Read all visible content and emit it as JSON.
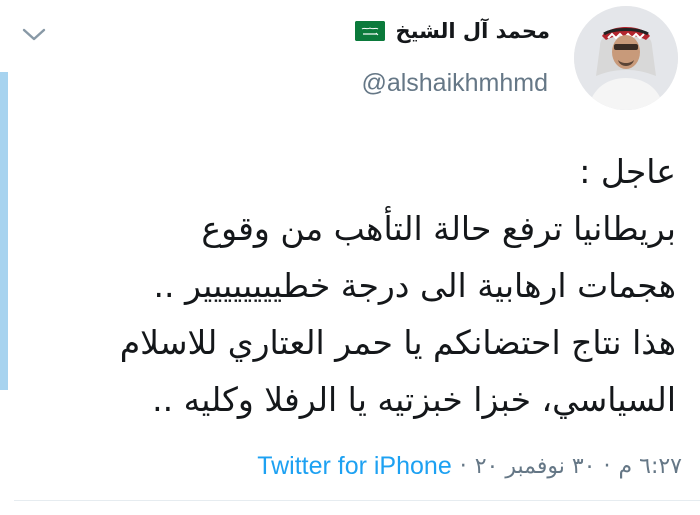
{
  "user": {
    "display_name": "محمد آل الشيخ",
    "handle": "@alshaikhmhmd",
    "flag_icon": "saudi-flag-icon",
    "avatar_icon": "profile-photo"
  },
  "tweet": {
    "lines": [
      "عاجل :",
      "بريطانيا ترفع حالة التأهب من وقوع",
      "هجمات ارهابية  الى درجة خطيييييييير ..",
      "هذا نتاج احتضانكم يا حمر العتاري للاسلام",
      "السياسي، خبزا خبزتيه يا الرفلا وكليه .."
    ]
  },
  "meta": {
    "time": "٦:٢٧ م",
    "date": "٣٠ نوفمبر ٢٠",
    "separator": "·",
    "source": "Twitter for iPhone"
  },
  "colors": {
    "text": "#14171a",
    "muted": "#657786",
    "link": "#1da1f2",
    "accent_bar": "#a7d3ef"
  },
  "icons": {
    "menu": "chevron-down-icon"
  }
}
